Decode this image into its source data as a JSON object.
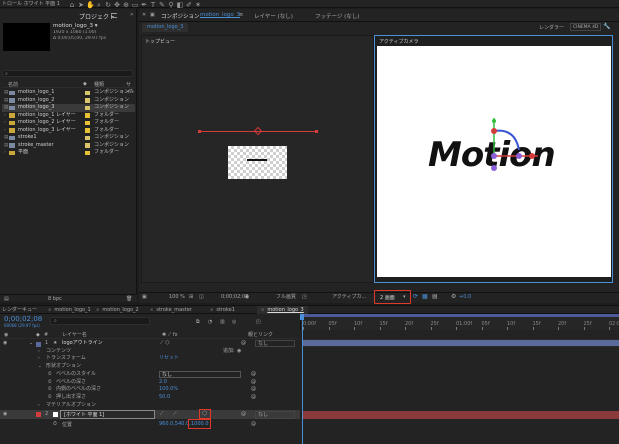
{
  "menubar": {
    "left_label": "トロール ホワイト 平面 1",
    "tools": [
      "home-icon",
      "arrow-icon",
      "hand-icon",
      "zoom-icon",
      "rotate-icon",
      "move-icon",
      "anchor-icon",
      "rect-icon",
      "pen-icon",
      "type-icon",
      "brush-icon",
      "stamp-icon",
      "eraser-icon",
      "roto-icon",
      "puppet-icon"
    ]
  },
  "project_panel": {
    "tab_label": "プロジェクト",
    "comp_name": "motion_logo_3 ▾",
    "comp_info_1": "1920 x 1080 (1.00)",
    "comp_info_2": "Δ 0;00;05;00, 29.97 fps",
    "search_placeholder": "",
    "header_name": "名前",
    "header_type": "種類",
    "header_size": "サイ",
    "items": [
      {
        "name": "motion_logo_1",
        "type": "コンポジション",
        "color": "#d8c46a",
        "kind": "comp"
      },
      {
        "name": "motion_logo_2",
        "type": "コンポジション",
        "color": "#d8c46a",
        "kind": "comp"
      },
      {
        "name": "motion_logo_3",
        "type": "コンポジション",
        "color": "#d8c46a",
        "kind": "comp"
      },
      {
        "name": "motion_logo_1 レイヤー",
        "type": "フォルダー",
        "color": "#e8c234",
        "kind": "folder"
      },
      {
        "name": "motion_logo_2 レイヤー",
        "type": "フォルダー",
        "color": "#e8c234",
        "kind": "folder"
      },
      {
        "name": "motion_logo_3 レイヤー",
        "type": "フォルダー",
        "color": "#e8c234",
        "kind": "folder"
      },
      {
        "name": "stroke1",
        "type": "コンポジション",
        "color": "#d8c46a",
        "kind": "comp"
      },
      {
        "name": "stroke_master",
        "type": "コンポジション",
        "color": "#d8c46a",
        "kind": "comp"
      },
      {
        "name": "平面",
        "type": "フォルダー",
        "color": "#e8c234",
        "kind": "folder"
      }
    ],
    "bpc": "8 bpc"
  },
  "comp_panel": {
    "tab_comp": "コンポジション",
    "tab_comp_name": "motion_logo_3",
    "tab_layer": "レイヤー (なし)",
    "tab_footage": "フッテージ (なし)",
    "renderer_label": "レンダラー",
    "renderer_value": "CINEMA 4D",
    "sub_tab": "motion_logo_3",
    "view_left": "トップビュー",
    "view_right": "アクティブカメラ",
    "logo_text": "Motion",
    "bottom": {
      "zoom": "100 %",
      "timecode": "0;00;02;08",
      "quality": "フル画質",
      "camera": "アクティブカ...",
      "views": "2 画面",
      "offset": "+0.0"
    }
  },
  "timeline": {
    "tabs": [
      "レンダーキュー",
      "motion_logo_1",
      "motion_logo_2",
      "stroke_master",
      "stroke1",
      "motion_logo_3"
    ],
    "active_tab": "motion_logo_3",
    "timecode": "0;00;02;08",
    "timecode_sub": "00068 (29.97 fps)",
    "search_placeholder": "",
    "header_layer": "レイヤー名",
    "header_parent": "親とリンク",
    "ruler": [
      "0:00f",
      "05f",
      "10f",
      "15f",
      "20f",
      "25f",
      "01:00f",
      "05f",
      "10f",
      "15f",
      "20f",
      "25f",
      "02:0"
    ],
    "rows": [
      {
        "num": "1",
        "name": "logoアウトライン",
        "parent": "なし",
        "level": 0
      },
      {
        "label": "コンテンツ",
        "level": 1,
        "extra": "追加:"
      },
      {
        "label": "トランスフォーム",
        "level": 1,
        "extra": "リセット"
      },
      {
        "label": "形状オプション",
        "level": 1
      },
      {
        "label": "ベベルのスタイル",
        "level": 2,
        "value": "なし"
      },
      {
        "label": "ベベルの深さ",
        "level": 2,
        "value": "2.0"
      },
      {
        "label": "内側のベベルの深さ",
        "level": 2,
        "value": "100.0%"
      },
      {
        "label": "押し出す深さ",
        "level": 2,
        "value": "50.0"
      },
      {
        "label": "マテリアルオプション",
        "level": 1
      }
    ],
    "layer2": {
      "num": "2",
      "name": "[ホワイト 平面 1]",
      "parent": "なし"
    },
    "position_label": "位置",
    "position_value": "960.0,540.0,",
    "position_highlight": "1000.0",
    "reset_label": "リセット",
    "add_label": "追加:"
  },
  "colors": {
    "accent": "#4a90d9",
    "highlight_box": "#e0392b",
    "layer_bar": "#8a3a3a",
    "work_area": "#4d5a9a"
  }
}
